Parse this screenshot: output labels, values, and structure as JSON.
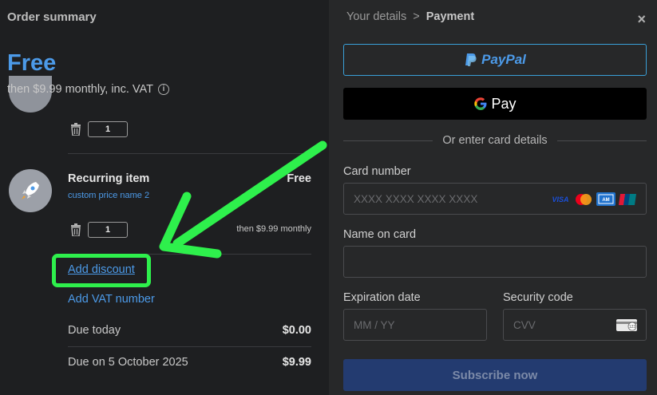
{
  "order": {
    "title": "Order summary",
    "price": "Free",
    "price_sub": "then $9.99 monthly, inc. VAT",
    "first_item_qty": "1",
    "item": {
      "name": "Recurring item",
      "price": "Free",
      "sub": "custom price name 2",
      "qty": "1",
      "recurring": "then $9.99 monthly"
    },
    "add_discount": "Add discount",
    "add_vat": "Add VAT number",
    "due_today_label": "Due today",
    "due_today_amount": "$0.00",
    "due_later_label": "Due on 5 October 2025",
    "due_later_amount": "$9.99"
  },
  "payment": {
    "crumb_1": "Your details",
    "crumb_sep": ">",
    "crumb_2": "Payment",
    "close": "×",
    "paypal_label": "PayPal",
    "gpay_label": "Pay",
    "or_text": "Or enter card details",
    "card_number_label": "Card number",
    "card_number_placeholder": "XXXX XXXX XXXX XXXX",
    "name_label": "Name on card",
    "name_placeholder": "",
    "expiry_label": "Expiration date",
    "expiry_placeholder": "MM / YY",
    "cvc_label": "Security code",
    "cvc_placeholder": "CVV",
    "subscribe": "Subscribe now",
    "card_brands": [
      "visa-icon",
      "mastercard-icon",
      "amex-icon",
      "unionpay-icon"
    ]
  },
  "colors": {
    "accent": "#4c9ae8",
    "highlight": "#2ef04c",
    "subscribe_bg": "#233b70"
  }
}
